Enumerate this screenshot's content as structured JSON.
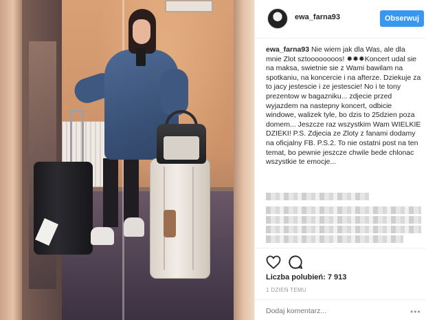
{
  "post": {
    "username": "ewa_farna93",
    "follow_label": "Obserwuj",
    "caption_user": "ewa_farna93",
    "caption_text": " Nie wiem jak dla Was, ale dla mnie Zlot sztoooooooos! ✹✹✹Koncert udal sie na maksa, swietnie sie z Wami bawilam na spotkaniu, na koncercie i na afterze. Dziekuje za to jacy jestescie i ze jestescie! No i te tony prezentow w bagazniku... zdjecie przed wyjazdem na nastepny koncert, odbicie windowe, walizek tyle, bo dzis to 25dzien poza domem... Jeszcze raz wszystkim Wam WIELKIE DZIEKI! P.S. Zdjecia ze Zloty z fanami dodamy na oficjalny FB. P.S.2. To nie ostatni post na ten temat, bo pewnie jeszcze chwile bede chlonac wszystkie te emocje...",
    "likes_label": "Liczba polubień:",
    "likes_count": "7 913",
    "time_label": "1 DZIEŃ TEMU",
    "comment_placeholder": "Dodaj komentarz...",
    "more_label": "•••"
  },
  "icons": {
    "heart": "heart-icon",
    "comment": "comment-bubble-icon",
    "more": "more-options-icon"
  },
  "colors": {
    "follow_button": "#3897f0",
    "border": "#efefef",
    "text": "#262626",
    "muted": "#999999"
  }
}
